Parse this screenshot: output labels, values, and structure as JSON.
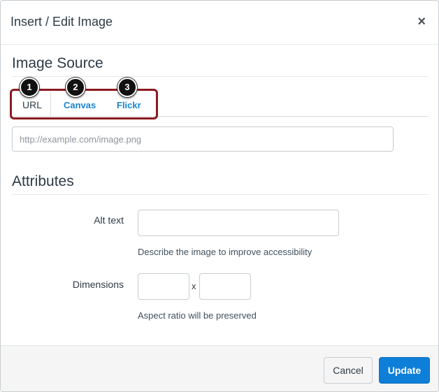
{
  "dialog": {
    "title": "Insert / Edit Image",
    "close_glyph": "×"
  },
  "source": {
    "heading": "Image Source",
    "tabs": [
      {
        "label": "URL",
        "active": true
      },
      {
        "label": "Canvas",
        "active": false
      },
      {
        "label": "Flickr",
        "active": false
      }
    ],
    "badges": [
      "1",
      "2",
      "3"
    ],
    "url_placeholder": "http://example.com/image.png",
    "url_value": ""
  },
  "attributes": {
    "heading": "Attributes",
    "alt_label": "Alt text",
    "alt_value": "",
    "alt_hint": "Describe the image to improve accessibility",
    "dimensions_label": "Dimensions",
    "width_value": "",
    "height_value": "",
    "times_glyph": "x",
    "dimensions_hint": "Aspect ratio will be preserved"
  },
  "footer": {
    "cancel_label": "Cancel",
    "update_label": "Update"
  },
  "colors": {
    "link": "#1a83d1",
    "primary": "#0e7fd9",
    "highlight": "#8b1a21"
  },
  "icons": {
    "close": "close-icon"
  }
}
